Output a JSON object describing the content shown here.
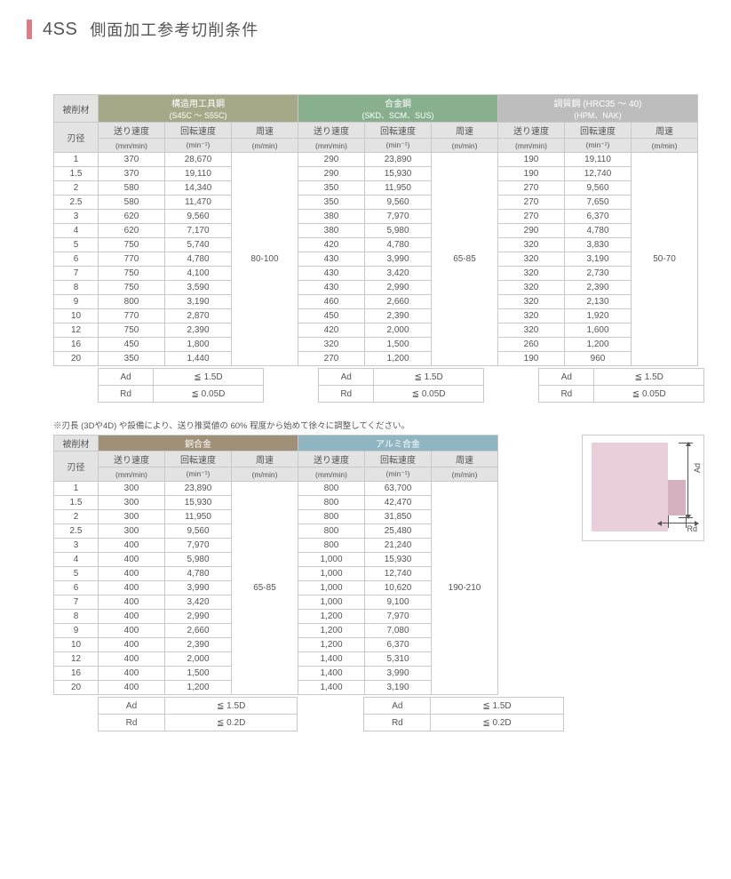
{
  "title": {
    "code": "4SS",
    "text": "側面加工参考切削条件"
  },
  "headers": {
    "material": "被削材",
    "dia": "刃径",
    "feed": "送り速度",
    "feed_unit": "(mm/min)",
    "rot": "回転速度",
    "rot_unit": "(min⁻¹)",
    "surf": "周速",
    "surf_unit": "(m/min)"
  },
  "groups1": [
    {
      "cls": "hdr-olive",
      "name": "構造用工具鋼",
      "sub": "(S45C ～ S55C)",
      "surf": "80-100",
      "ad": "≦ 1.5D",
      "rd": "≦ 0.05D"
    },
    {
      "cls": "hdr-green",
      "name": "合金鋼",
      "sub": "(SKD、SCM、SUS)",
      "surf": "65-85",
      "ad": "≦ 1.5D",
      "rd": "≦ 0.05D"
    },
    {
      "cls": "hdr-dgray",
      "name": "調質鋼 (HRC35 ～ 40)",
      "sub": "(HPM、NAK)",
      "surf": "50-70",
      "ad": "≦ 1.5D",
      "rd": "≦ 0.05D"
    }
  ],
  "table1": {
    "dia": [
      "1",
      "1.5",
      "2",
      "2.5",
      "3",
      "4",
      "5",
      "6",
      "7",
      "8",
      "9",
      "10",
      "12",
      "16",
      "20"
    ],
    "cols": [
      {
        "feed": [
          "370",
          "370",
          "580",
          "580",
          "620",
          "620",
          "750",
          "770",
          "750",
          "750",
          "800",
          "770",
          "750",
          "450",
          "350"
        ],
        "rot": [
          "28,670",
          "19,110",
          "14,340",
          "11,470",
          "9,560",
          "7,170",
          "5,740",
          "4,780",
          "4,100",
          "3,590",
          "3,190",
          "2,870",
          "2,390",
          "1,800",
          "1,440"
        ]
      },
      {
        "feed": [
          "290",
          "290",
          "350",
          "350",
          "380",
          "380",
          "420",
          "430",
          "430",
          "430",
          "460",
          "450",
          "420",
          "320",
          "270"
        ],
        "rot": [
          "23,890",
          "15,930",
          "11,950",
          "9,560",
          "7,970",
          "5,980",
          "4,780",
          "3,990",
          "3,420",
          "2,990",
          "2,660",
          "2,390",
          "2,000",
          "1,500",
          "1,200"
        ]
      },
      {
        "feed": [
          "190",
          "190",
          "270",
          "270",
          "270",
          "290",
          "320",
          "320",
          "320",
          "320",
          "320",
          "320",
          "320",
          "260",
          "190"
        ],
        "rot": [
          "19,110",
          "12,740",
          "9,560",
          "7,650",
          "6,370",
          "4,780",
          "3,830",
          "3,190",
          "2,730",
          "2,390",
          "2,130",
          "1,920",
          "1,600",
          "1,200",
          "960"
        ]
      }
    ]
  },
  "note": "※刃長 (3Dや4D) や設備により、送り推奨値の 60% 程度から始めて徐々に調整してください。",
  "groups2": [
    {
      "cls": "hdr-brown",
      "name": "銅合金",
      "surf": "65-85",
      "ad": "≦ 1.5D",
      "rd": "≦ 0.2D"
    },
    {
      "cls": "hdr-blue",
      "name": "アルミ合金",
      "surf": "190-210",
      "ad": "≦ 1.5D",
      "rd": "≦ 0.2D"
    }
  ],
  "table2": {
    "dia": [
      "1",
      "1.5",
      "2",
      "2.5",
      "3",
      "4",
      "5",
      "6",
      "7",
      "8",
      "9",
      "10",
      "12",
      "16",
      "20"
    ],
    "cols": [
      {
        "feed": [
          "300",
          "300",
          "300",
          "300",
          "400",
          "400",
          "400",
          "400",
          "400",
          "400",
          "400",
          "400",
          "400",
          "400",
          "400"
        ],
        "rot": [
          "23,890",
          "15,930",
          "11,950",
          "9,560",
          "7,970",
          "5,980",
          "4,780",
          "3,990",
          "3,420",
          "2,990",
          "2,660",
          "2,390",
          "2,000",
          "1,500",
          "1,200"
        ]
      },
      {
        "feed": [
          "800",
          "800",
          "800",
          "800",
          "800",
          "1,000",
          "1,000",
          "1,000",
          "1,000",
          "1,200",
          "1,200",
          "1,200",
          "1,400",
          "1,400",
          "1,400"
        ],
        "rot": [
          "63,700",
          "42,470",
          "31,850",
          "25,480",
          "21,240",
          "15,930",
          "12,740",
          "10,620",
          "9,100",
          "7,970",
          "7,080",
          "6,370",
          "5,310",
          "3,990",
          "3,190"
        ]
      }
    ]
  },
  "adrd_labels": {
    "ad": "Ad",
    "rd": "Rd"
  },
  "diagram": {
    "ad": "Ad",
    "rd": "Rd"
  }
}
